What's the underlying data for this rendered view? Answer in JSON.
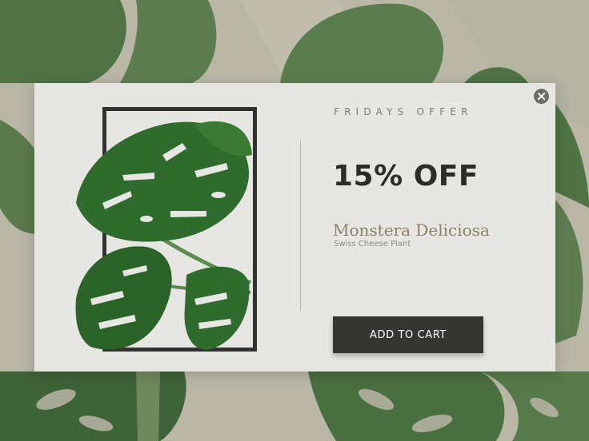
{
  "colors": {
    "background": "#b9b6a6",
    "modal": "#e6e7e2",
    "frame": "#323232",
    "leaf": "#2f6b2d",
    "button": "#353534",
    "accent_serif": "#8a8167"
  },
  "offer": {
    "eyebrow": "FRIDAYS OFFER",
    "headline": "15% OFF",
    "product_name": "Monstera Deliciosa",
    "product_subtitle": "Swiss Cheese Plant",
    "cta_label": "ADD TO CART"
  },
  "icons": {
    "close": "close-icon"
  }
}
